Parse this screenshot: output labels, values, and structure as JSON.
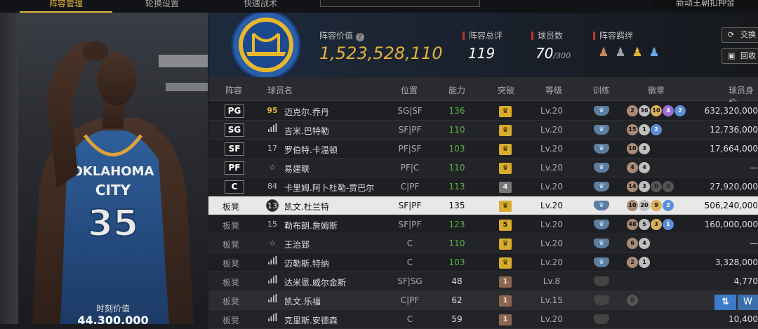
{
  "top_tabs": [
    {
      "label": "阵容管理",
      "active": true
    },
    {
      "label": "轮换设置",
      "active": false
    },
    {
      "label": "快速战术",
      "active": false
    }
  ],
  "top_right": {
    "label": "新动王朝扣押金"
  },
  "left": {
    "time_value_label": "时刻价值",
    "time_value": "44,300,000"
  },
  "header": {
    "lineup_value_label": "阵容价值",
    "lineup_value": "1,523,528,110",
    "overall_label": "阵容总评",
    "overall_value": "119",
    "count_label": "球员数",
    "count_value": "70",
    "count_max": "/300",
    "synergy_label": "阵容羁绊",
    "buttons": [
      {
        "label": "交换",
        "icon": "swap-icon"
      },
      {
        "label": "回收",
        "icon": "recycle-icon"
      }
    ]
  },
  "columns": [
    "阵容",
    "球员名",
    "位置",
    "能力",
    "突破",
    "等级",
    "训练",
    "徽章",
    "球员身价"
  ],
  "rows": [
    {
      "slot": "PG",
      "jersey": "95",
      "name": "迈克尔.乔丹",
      "pos": "SG|SF",
      "rating": "136",
      "break": "crown",
      "level": "Lv.20",
      "train": "blue",
      "badges": [
        [
          "2",
          "bronze"
        ],
        [
          "36",
          "silver"
        ],
        [
          "10",
          "gold"
        ],
        [
          "4",
          "purple"
        ],
        [
          "2",
          "blue"
        ]
      ],
      "value": "632,320,000"
    },
    {
      "slot": "SG",
      "jersey": "",
      "name": "吉米.巴特勒",
      "pos": "SF|PF",
      "rating": "110",
      "break": "crown",
      "level": "Lv.20",
      "train": "blue",
      "badges": [
        [
          "15",
          "bronze"
        ],
        [
          "1",
          "silver"
        ],
        [
          "2",
          "blue"
        ]
      ],
      "value": "12,736,000"
    },
    {
      "slot": "SF",
      "jersey": "17",
      "name": "罗伯特.卡温顿",
      "pos": "PF|SF",
      "rating": "103",
      "break": "crown",
      "level": "Lv.20",
      "train": "blue",
      "badges": [
        [
          "10",
          "bronze"
        ],
        [
          "3",
          "silver"
        ]
      ],
      "value": "17,664,000"
    },
    {
      "slot": "PF",
      "jersey": "☆",
      "name": "易建联",
      "pos": "PF|C",
      "rating": "110",
      "break": "crown",
      "level": "Lv.20",
      "train": "blue",
      "badges": [
        [
          "4",
          "bronze"
        ],
        [
          "4",
          "silver"
        ]
      ],
      "value": "—"
    },
    {
      "slot": "C",
      "jersey": "84",
      "name": "卡里姆.阿卜杜勒-贾巴尔",
      "pos": "C|PF",
      "rating": "113",
      "break": "4",
      "level": "Lv.20",
      "train": "blue",
      "badges": [
        [
          "14",
          "bronze"
        ],
        [
          "3",
          "silver"
        ],
        [
          "0",
          "dark"
        ],
        [
          "0",
          "dark"
        ]
      ],
      "value": "27,920,000"
    },
    {
      "slot": "板凳",
      "jersey": "13",
      "name": "凯文.杜兰特",
      "pos": "SF|PF",
      "rating": "135",
      "break": "crown",
      "level": "Lv.20",
      "train": "blue",
      "badges": [
        [
          "10",
          "bronze"
        ],
        [
          "20",
          "silver"
        ],
        [
          "9",
          "gold"
        ],
        [
          "2",
          "blue"
        ]
      ],
      "value": "506,240,000"
    },
    {
      "slot": "板凳",
      "jersey": "15",
      "name": "勒布朗.詹姆斯",
      "pos": "SF|PF",
      "rating": "123",
      "break": "5",
      "level": "Lv.20",
      "train": "blue",
      "badges": [
        [
          "48",
          "bronze"
        ],
        [
          "5",
          "silver"
        ],
        [
          "3",
          "gold"
        ],
        [
          "1",
          "blue"
        ]
      ],
      "value": "160,000,000"
    },
    {
      "slot": "板凳",
      "jersey": "☆",
      "name": "王治郅",
      "pos": "C",
      "rating": "110",
      "break": "crown",
      "level": "Lv.20",
      "train": "blue",
      "badges": [
        [
          "6",
          "bronze"
        ],
        [
          "4",
          "silver"
        ]
      ],
      "value": "—"
    },
    {
      "slot": "板凳",
      "jersey": "",
      "name": "迈勒斯.特纳",
      "pos": "C",
      "rating": "103",
      "break": "crown",
      "level": "Lv.20",
      "train": "blue",
      "badges": [
        [
          "2",
          "bronze"
        ],
        [
          "1",
          "silver"
        ]
      ],
      "value": "3,328,000"
    },
    {
      "slot": "板凳",
      "jersey": "",
      "name": "达米恩.威尔金斯",
      "pos": "SF|SG",
      "rating": "48",
      "break": "1",
      "level": "Lv.8",
      "train": "grey",
      "badges": [],
      "value": "4,770"
    },
    {
      "slot": "板凳",
      "jersey": "",
      "name": "凯文.乐福",
      "pos": "C|PF",
      "rating": "62",
      "break": "1",
      "level": "Lv.15",
      "train": "grey",
      "badges": [
        [
          "0",
          "dark"
        ]
      ],
      "value": ""
    },
    {
      "slot": "板凳",
      "jersey": "",
      "name": "克里斯.安德森",
      "pos": "C",
      "rating": "59",
      "break": "1",
      "level": "Lv.20",
      "train": "grey",
      "badges": [],
      "value": "10,400"
    }
  ]
}
